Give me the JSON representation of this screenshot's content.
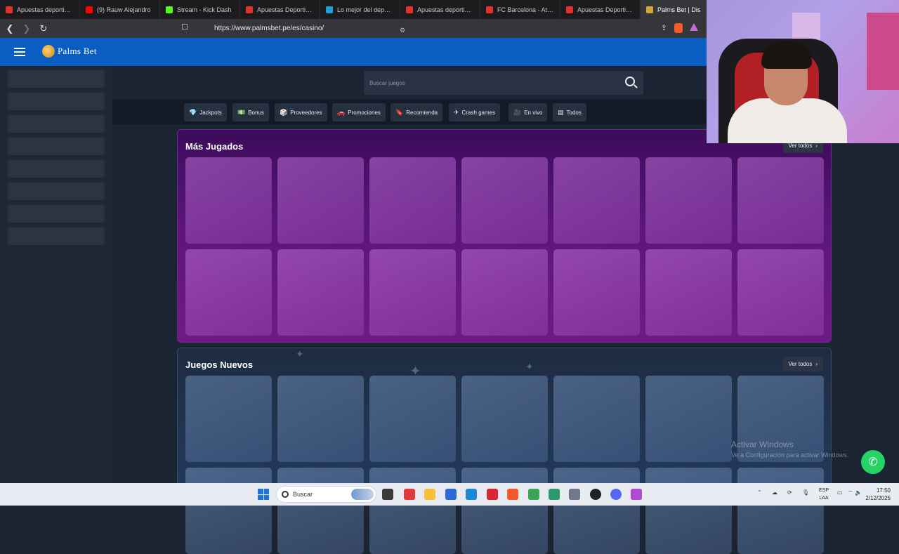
{
  "browser": {
    "tabs": [
      {
        "label": "Apuestas deportivas |",
        "color": "#e0342b"
      },
      {
        "label": "(9) Rauw Alejandro",
        "color": "#ff0000"
      },
      {
        "label": "Stream - Kick Dash",
        "color": "#53fc18"
      },
      {
        "label": "Apuestas Deportivas O",
        "color": "#e0342b"
      },
      {
        "label": "Lo mejor del deporte y",
        "color": "#1fa1d8"
      },
      {
        "label": "Apuestas deportivas | A",
        "color": "#e0342b"
      },
      {
        "label": "FC Barcelona - Atlético",
        "color": "#e0342b"
      },
      {
        "label": "Apuestas Deportivas -",
        "color": "#e0342b"
      },
      {
        "label": "Palms Bet | Dis",
        "color": "#d6a63a"
      }
    ],
    "url": "https://www.palmsbet.pe/es/casino/"
  },
  "site": {
    "brand": "Palms Bet",
    "search_placeholder": "Buscar juegos",
    "categories": [
      {
        "label": "Jackpots",
        "icon": "💎"
      },
      {
        "label": "Bonus",
        "icon": "💵"
      },
      {
        "label": "Proveedores",
        "icon": "🎲"
      },
      {
        "label": "Promociones",
        "icon": "🚗"
      },
      {
        "label": "Recomienda",
        "icon": "🔖"
      },
      {
        "label": "Crash games",
        "icon": "✈"
      },
      {
        "label": "En vivo",
        "icon": "🎥"
      },
      {
        "label": "Todos",
        "icon": "▤"
      }
    ],
    "sections": [
      {
        "title": "Más Jugados",
        "see_all": "Ver todos"
      },
      {
        "title": "Juegos Nuevos",
        "see_all": "Ver todos"
      }
    ]
  },
  "overlay": {
    "watermark_title": "Activar Windows",
    "watermark_sub": "Ve a Configuración para activar Windows."
  },
  "taskbar": {
    "search_label": "Buscar",
    "lang_line1": "ESP",
    "lang_line2": "LAA",
    "time": "17:50",
    "date": "2/12/2025"
  }
}
